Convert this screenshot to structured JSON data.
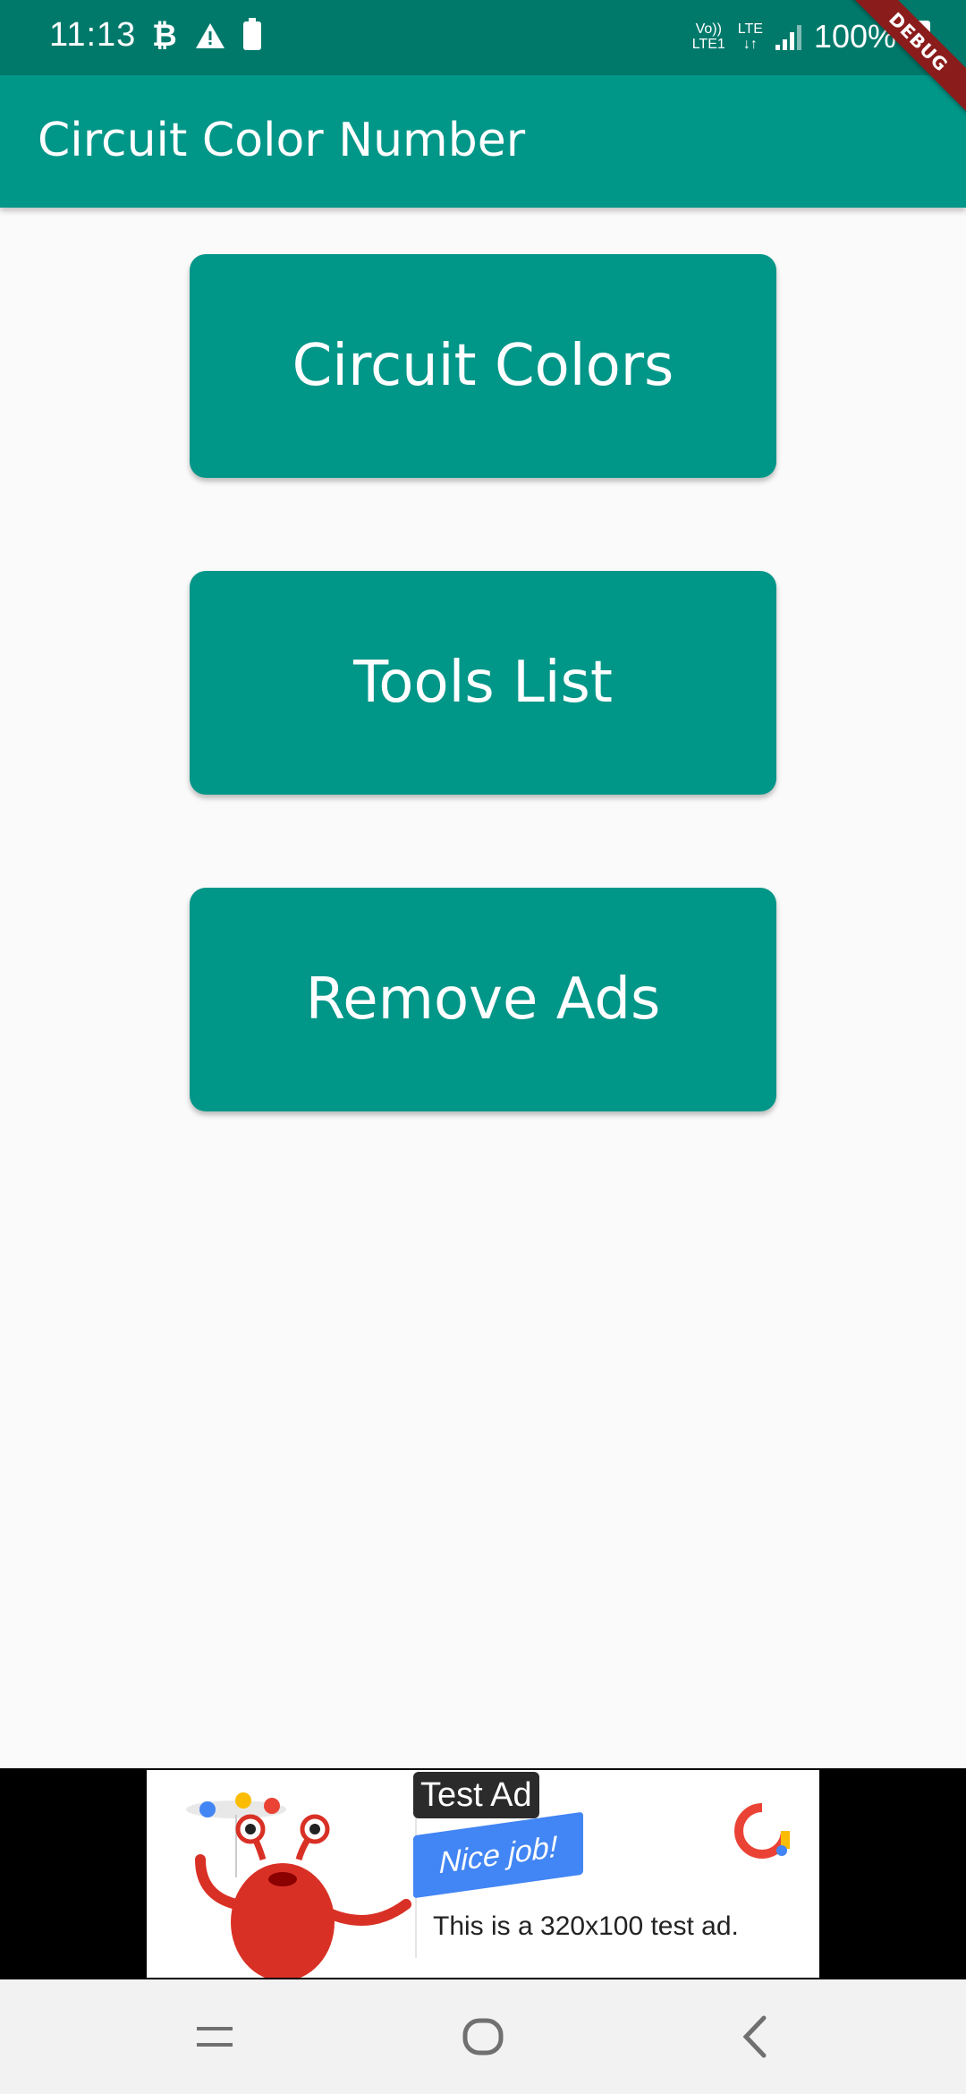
{
  "status_bar": {
    "time": "11:13",
    "network_top": "Vo))",
    "network_bottom": "LTE1",
    "lte_label": "LTE",
    "battery": "100%",
    "icons": [
      "bitcoin-icon",
      "warning-icon",
      "battery-saver-icon",
      "signal-icon",
      "battery-icon"
    ]
  },
  "debug_banner": "DEBUG",
  "app_bar": {
    "title": "Circuit Color Number"
  },
  "buttons": {
    "circuit_colors": "Circuit Colors",
    "tools_list": "Tools List",
    "remove_ads": "Remove Ads"
  },
  "ad": {
    "label": "Test Ad",
    "banner_text": "Nice job!",
    "body": "This is a 320x100 test ad."
  },
  "nav": {
    "icons": [
      "recent-apps-icon",
      "home-icon",
      "back-icon"
    ]
  },
  "colors": {
    "primary": "#009688",
    "primary_dark": "#00796b",
    "background": "#fafafa",
    "debug": "#8b1c1c"
  }
}
